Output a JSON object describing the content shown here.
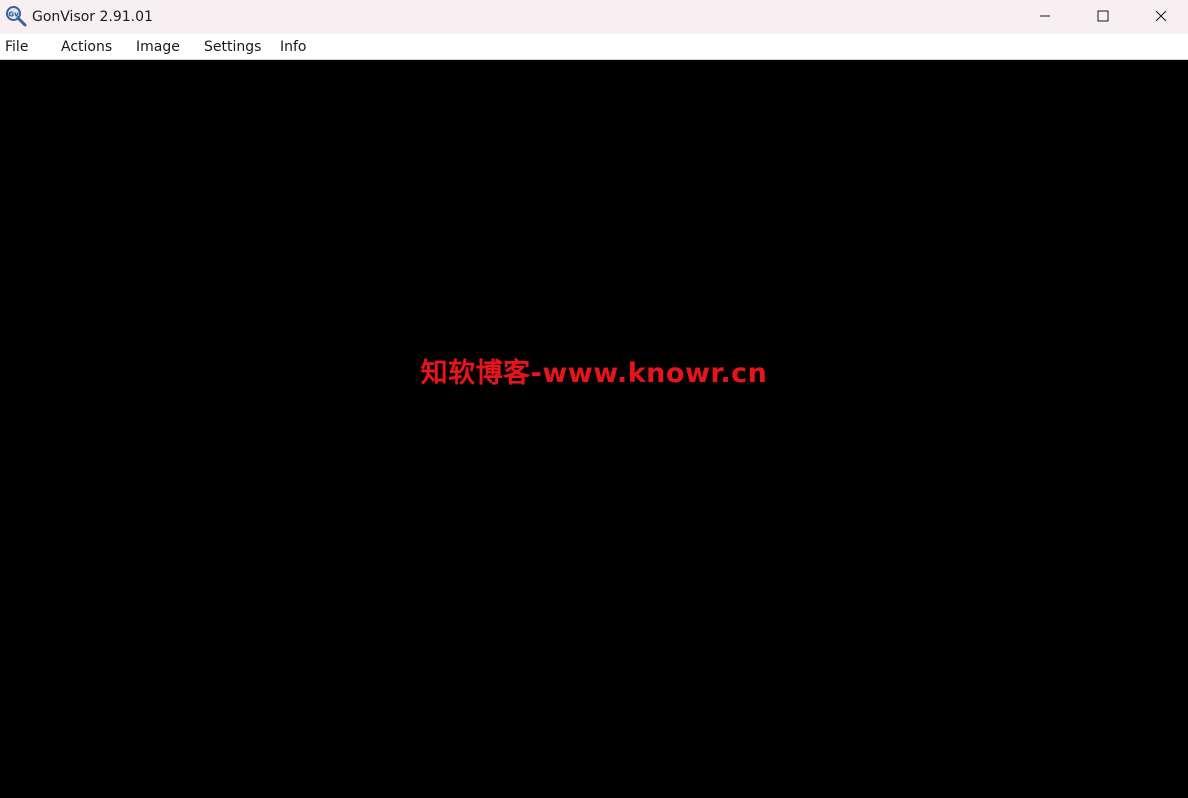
{
  "window": {
    "title": "GonVisor 2.91.01",
    "app_icon": "gonvisor-magnifier-icon",
    "controls": {
      "minimize_icon": "minimize-icon",
      "maximize_icon": "maximize-icon",
      "close_icon": "close-icon"
    }
  },
  "menu": {
    "file": "File",
    "actions": "Actions",
    "image": "Image",
    "settings": "Settings",
    "info": "Info"
  },
  "viewer": {
    "watermark": "知软博客-www.knowr.cn",
    "watermark_color": "#e8141c",
    "background_color": "#000000"
  }
}
